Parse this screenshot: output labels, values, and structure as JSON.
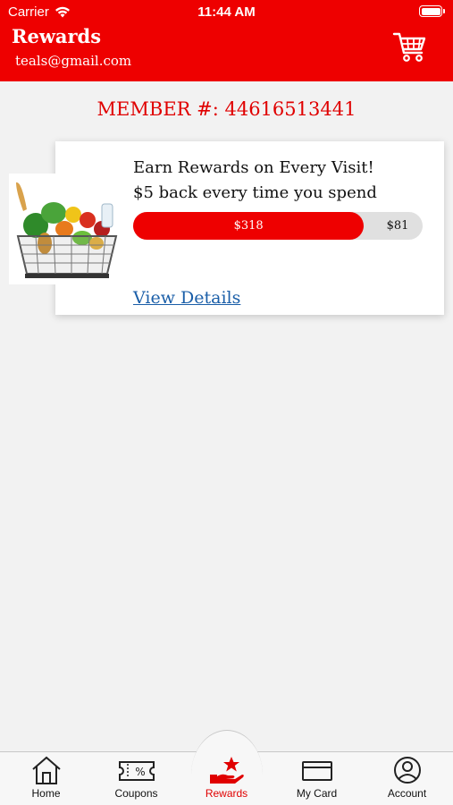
{
  "status_bar": {
    "carrier": "Carrier",
    "time": "11:44 AM"
  },
  "header": {
    "title": "Rewards",
    "email": "teals@gmail.com"
  },
  "member": {
    "text": "MEMBER #: 44616513441"
  },
  "reward_card": {
    "headline": "Earn Rewards on Every Visit!",
    "subline": "$5 back every time you spend",
    "progress_spent_label": "$318",
    "progress_remaining_label": "$81",
    "progress_fraction": 0.797,
    "link": "View Details"
  },
  "tabs": [
    {
      "label": "Home",
      "icon": "home-icon",
      "active": false
    },
    {
      "label": "Coupons",
      "icon": "coupon-icon",
      "active": false
    },
    {
      "label": "Rewards",
      "icon": "rewards-icon",
      "active": true
    },
    {
      "label": "My Card",
      "icon": "card-icon",
      "active": false
    },
    {
      "label": "Account",
      "icon": "account-icon",
      "active": false
    }
  ],
  "colors": {
    "accent": "#ee0000",
    "link": "#1a5ea8",
    "background": "#f2f2f2"
  }
}
